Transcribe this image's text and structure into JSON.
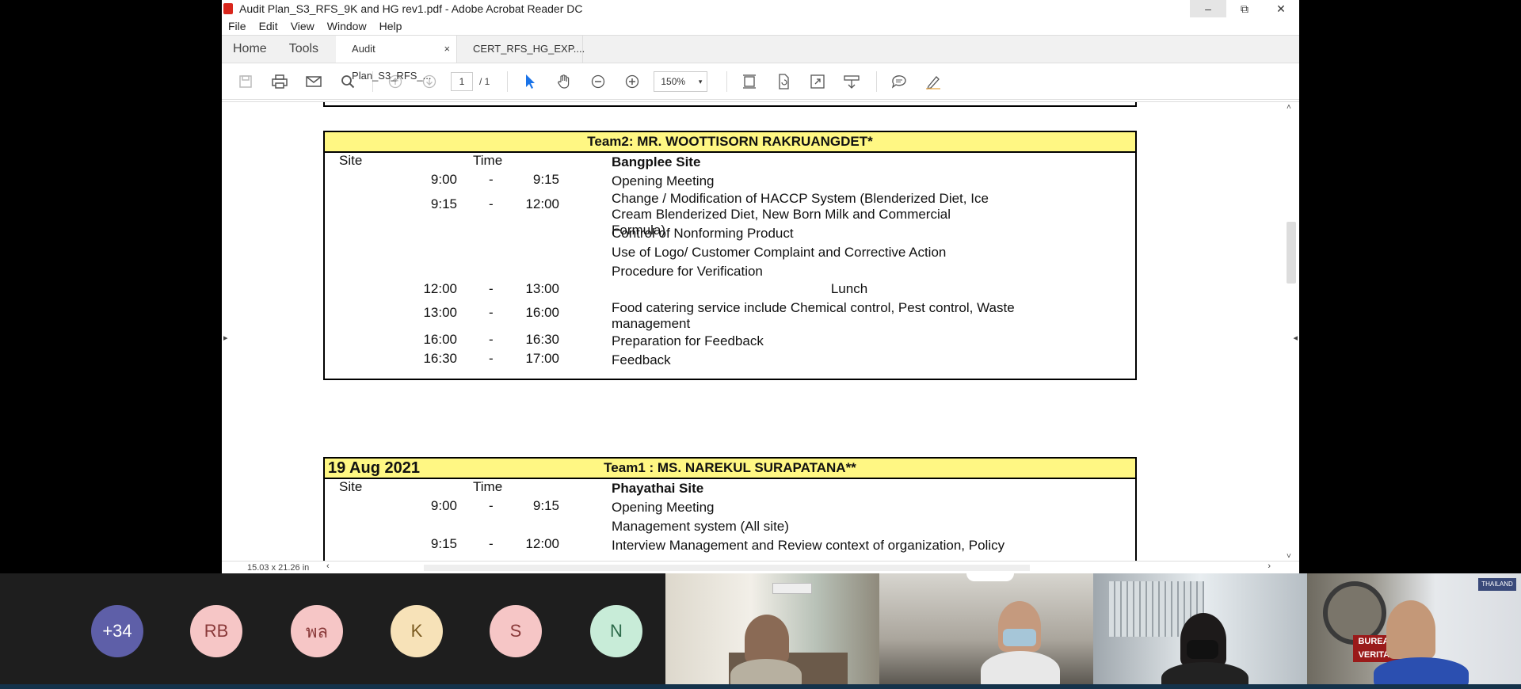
{
  "window": {
    "title": "Audit Plan_S3_RFS_9K and HG rev1.pdf - Adobe Acrobat Reader DC",
    "minimize": "–",
    "restore": "⧉",
    "close": "✕"
  },
  "menu": [
    "File",
    "Edit",
    "View",
    "Window",
    "Help"
  ],
  "tabs": {
    "home": "Home",
    "tools": "Tools",
    "docs": [
      {
        "label": "Audit Plan_S3_RFS_...",
        "close": "×"
      },
      {
        "label": "CERT_RFS_HG_EXP...."
      }
    ]
  },
  "toolbar": {
    "page_current": "1",
    "page_total": "/ 1",
    "zoom": "150%",
    "zoom_caret": "▾"
  },
  "status": {
    "page_size": "15.03 x 21.26 in",
    "scroll_left": "‹",
    "scroll_right": "›",
    "scroll_up": "˄",
    "scroll_down": "˅",
    "side_left": "▸",
    "side_right": "◂"
  },
  "team2": {
    "header": "Team2: MR. WOOTTISORN RAKRUANGDET*",
    "col_site": "Site",
    "col_time": "Time",
    "site_name": "Bangplee Site",
    "rows": [
      {
        "t1": "9:00",
        "dash": "-",
        "t2": "9:15",
        "activity": "Opening Meeting"
      },
      {
        "t1": "9:15",
        "dash": "-",
        "t2": "12:00",
        "activity": "Change / Modification of HACCP System (Blenderized Diet, Ice Cream Blenderized Diet, New Born Milk and Commercial Formula)"
      },
      {
        "activity": "Control of Nonforming Product"
      },
      {
        "activity": "Use of Logo/ Customer Complaint and Corrective Action"
      },
      {
        "activity": "Procedure for Verification"
      },
      {
        "t1": "12:00",
        "dash": "-",
        "t2": "13:00",
        "activity": "Lunch"
      },
      {
        "t1": "13:00",
        "dash": "-",
        "t2": "16:00",
        "activity": "Food catering service include Chemical control, Pest control, Waste management"
      },
      {
        "t1": "16:00",
        "dash": "-",
        "t2": "16:30",
        "activity": "Preparation for Feedback"
      },
      {
        "t1": "16:30",
        "dash": "-",
        "t2": "17:00",
        "activity": "Feedback"
      }
    ]
  },
  "team1": {
    "date": "19 Aug 2021",
    "header": "Team1 : MS. NAREKUL SURAPATANA**",
    "col_site": "Site",
    "col_time": "Time",
    "site_name": "Phayathai Site",
    "rows": [
      {
        "t1": "9:00",
        "dash": "-",
        "t2": "9:15",
        "activity": "Opening Meeting"
      },
      {
        "activity": "Management system (All site)"
      },
      {
        "t1": "9:15",
        "dash": "-",
        "t2": "12:00",
        "activity": "Interview Management and Review context of organization, Policy"
      }
    ]
  },
  "meeting": {
    "participants": [
      {
        "initials": "+34",
        "color": "#5e5fa8",
        "text_color": "#ffffff"
      },
      {
        "initials": "RB",
        "color": "#f6c6c6",
        "text_color": "#8a3a3a"
      },
      {
        "initials": "พล",
        "color": "#f6c6c6",
        "text_color": "#8a3a3a"
      },
      {
        "initials": "K",
        "color": "#f7e2b8",
        "text_color": "#7a5a20"
      },
      {
        "initials": "S",
        "color": "#f6c6c6",
        "text_color": "#8a3a3a"
      },
      {
        "initials": "N",
        "color": "#c8ecd8",
        "text_color": "#2d6a4a"
      }
    ],
    "badge": "THAILAND",
    "logo_text": "BUREAU VERITAS"
  }
}
